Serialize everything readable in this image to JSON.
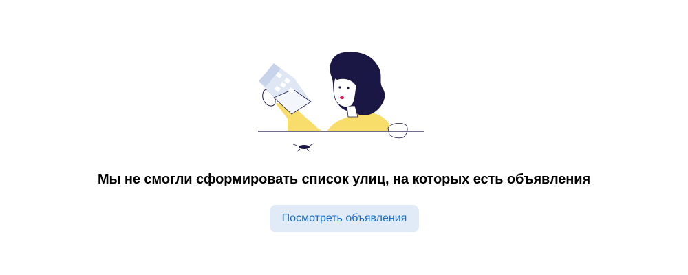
{
  "empty_state": {
    "illustration": "woman-holding-building-illustration",
    "message": "Мы не смогли сформировать список улиц, на которых есть объявления",
    "button_label": "Посмотреть объявления"
  },
  "colors": {
    "accent_text": "#1a6dc7",
    "button_background": "#e1ebf7",
    "hair": "#1b1744",
    "sweater": "#f9dd6b"
  }
}
